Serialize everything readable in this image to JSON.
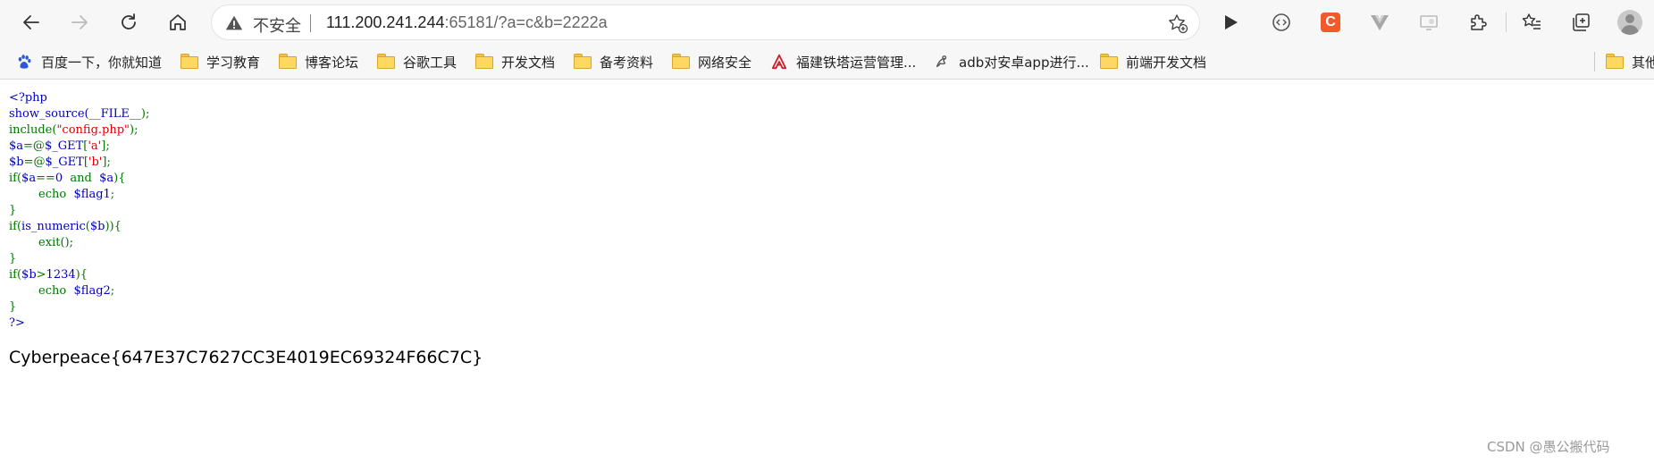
{
  "address_bar": {
    "security_label": "不安全",
    "url_host": "111.200.241.244",
    "url_rest": ":65181/?a=c&b=2222a"
  },
  "bookmarks": [
    {
      "label": "百度一下，你就知道",
      "icon": "baidu-paw-icon"
    },
    {
      "label": "学习教育",
      "icon": "folder-icon"
    },
    {
      "label": "博客论坛",
      "icon": "folder-icon"
    },
    {
      "label": "谷歌工具",
      "icon": "folder-icon"
    },
    {
      "label": "开发文档",
      "icon": "folder-icon"
    },
    {
      "label": "备考资料",
      "icon": "folder-icon"
    },
    {
      "label": "网络安全",
      "icon": "folder-icon"
    },
    {
      "label": "福建铁塔运营管理...",
      "icon": "tower-logo-icon"
    },
    {
      "label": "adb对安卓app进行...",
      "icon": "bookmark-page-icon"
    },
    {
      "label": "前端开发文档",
      "icon": "folder-icon"
    }
  ],
  "bookmarks_overflow": "其他",
  "extension_badge": "C",
  "source_code": {
    "l1": "<?php",
    "l2a": "show_source(",
    "l2b": "__FILE__",
    "l2c": ");",
    "l3a": "include(",
    "l3b": "\"config.php\"",
    "l3c": ");",
    "l4a": "$a",
    "l4b": "=@",
    "l4c": "$_GET",
    "l4d": "[",
    "l4e": "'a'",
    "l4f": "];",
    "l5a": "$b",
    "l5b": "=@",
    "l5c": "$_GET",
    "l5d": "[",
    "l5e": "'b'",
    "l5f": "];",
    "l6a": "if(",
    "l6b": "$a",
    "l6c": "==",
    "l6d": "0 ",
    "l6e": " and ",
    "l6f": " $a",
    "l6g": "){",
    "l7a": "        echo ",
    "l7b": " $flag1",
    "l7c": ";",
    "l8": "}",
    "l9a": "if(",
    "l9b": "is_numeric",
    "l9c": "(",
    "l9d": "$b",
    "l9e": ")){",
    "l10a": "        exit",
    "l10b": "();",
    "l11": "}",
    "l12a": "if(",
    "l12b": "$b",
    "l12c": ">",
    "l12d": "1234",
    "l12e": "){",
    "l13a": "        echo ",
    "l13b": " $flag2",
    "l13c": ";",
    "l14": "}",
    "l15": "?>"
  },
  "flag_output": "Cyberpeace{647E37C7627CC3E4019EC69324F66C7C}",
  "watermark": "CSDN @愚公搬代码",
  "colors": {
    "php_keyword": "#007700",
    "php_default": "#0000bb",
    "php_string": "#dd0000",
    "extension_badge": "#f25a2b"
  }
}
